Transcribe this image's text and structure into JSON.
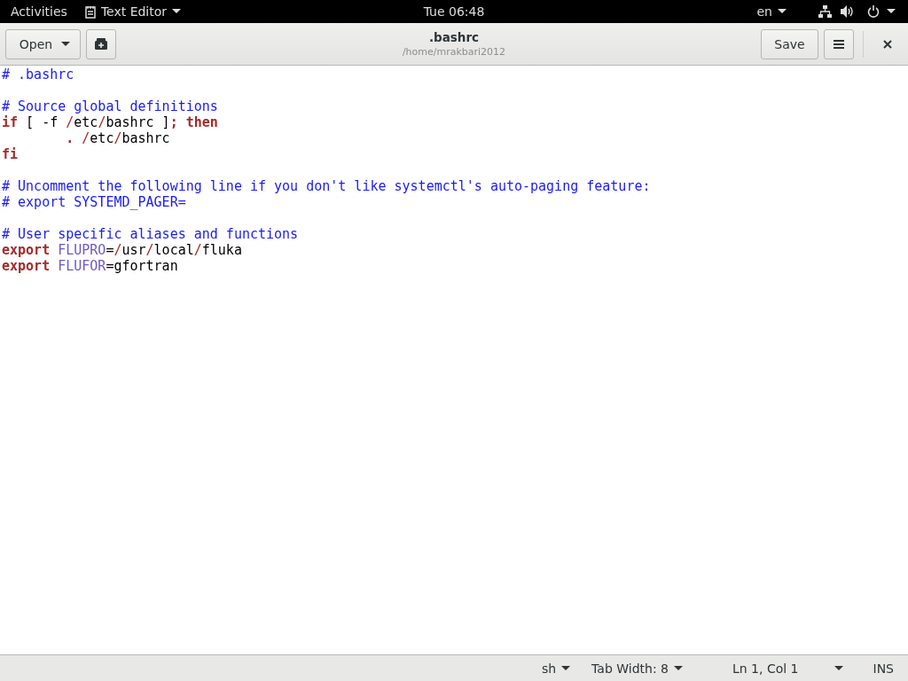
{
  "top_bar": {
    "activities": "Activities",
    "app_menu": "Text Editor",
    "clock": "Tue 06:48",
    "language": "en"
  },
  "header_bar": {
    "open_button": "Open",
    "title": ".bashrc",
    "subtitle": "/home/mrakbari2012",
    "save_button": "Save"
  },
  "editor": {
    "lines": [
      {
        "kind": "code",
        "tokens": [
          {
            "text": "# .bashrc",
            "kind": "comment"
          }
        ]
      },
      {
        "kind": "blank"
      },
      {
        "kind": "code",
        "tokens": [
          {
            "text": "# Source global definitions",
            "kind": "comment"
          }
        ]
      },
      {
        "kind": "code",
        "tokens": [
          {
            "text": "if",
            "kind": "keyword"
          },
          {
            "text": " [ -f ",
            "kind": "plain"
          },
          {
            "text": "/",
            "kind": "slash"
          },
          {
            "text": "etc",
            "kind": "plain"
          },
          {
            "text": "/",
            "kind": "slash"
          },
          {
            "text": "bashrc ]",
            "kind": "plain"
          },
          {
            "text": "; then",
            "kind": "keyword"
          }
        ]
      },
      {
        "kind": "code",
        "tokens": [
          {
            "text": "        . ",
            "kind": "keyword"
          },
          {
            "text": "/",
            "kind": "slash"
          },
          {
            "text": "etc",
            "kind": "plain"
          },
          {
            "text": "/",
            "kind": "slash"
          },
          {
            "text": "bashrc",
            "kind": "plain"
          }
        ]
      },
      {
        "kind": "code",
        "tokens": [
          {
            "text": "fi",
            "kind": "keyword"
          }
        ]
      },
      {
        "kind": "blank"
      },
      {
        "kind": "code",
        "tokens": [
          {
            "text": "# Uncomment the following line if you don't like systemctl's auto-paging feature:",
            "kind": "comment"
          }
        ]
      },
      {
        "kind": "code",
        "tokens": [
          {
            "text": "# export SYSTEMD_PAGER=",
            "kind": "comment"
          }
        ]
      },
      {
        "kind": "blank"
      },
      {
        "kind": "code",
        "tokens": [
          {
            "text": "# User specific aliases and functions",
            "kind": "comment"
          }
        ]
      },
      {
        "kind": "code",
        "tokens": [
          {
            "text": "export ",
            "kind": "keyword"
          },
          {
            "text": "FLUPRO",
            "kind": "variable"
          },
          {
            "text": "=",
            "kind": "plain"
          },
          {
            "text": "/",
            "kind": "slash"
          },
          {
            "text": "usr",
            "kind": "plain"
          },
          {
            "text": "/",
            "kind": "slash"
          },
          {
            "text": "local",
            "kind": "plain"
          },
          {
            "text": "/",
            "kind": "slash"
          },
          {
            "text": "fluka",
            "kind": "plain"
          }
        ]
      },
      {
        "kind": "code",
        "tokens": [
          {
            "text": "export ",
            "kind": "keyword"
          },
          {
            "text": "FLUFOR",
            "kind": "variable"
          },
          {
            "text": "=gfortran",
            "kind": "plain"
          }
        ]
      }
    ]
  },
  "status_bar": {
    "language": "sh",
    "tab_width": "Tab Width: 8",
    "position": "Ln 1, Col 1",
    "mode": "INS"
  }
}
